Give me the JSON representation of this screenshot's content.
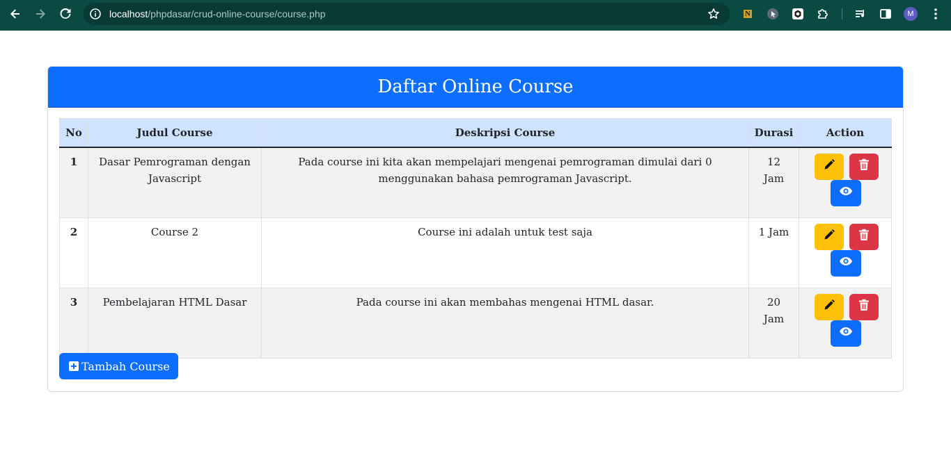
{
  "browser": {
    "url_host": "localhost",
    "url_path": "/phpdasar/crud-online-course/course.php",
    "extension_label": "N",
    "profile_initial": "M"
  },
  "page": {
    "title": "Daftar Online Course",
    "add_button_label": "Tambah Course"
  },
  "table": {
    "headers": {
      "no": "No",
      "judul": "Judul Course",
      "deskripsi": "Deskripsi Course",
      "durasi": "Durasi",
      "action": "Action"
    },
    "rows": [
      {
        "no": "1",
        "judul": "Dasar Pemrograman dengan Javascript",
        "deskripsi": "Pada course ini kita akan mempelajari mengenai pemrograman dimulai dari 0 menggunakan bahasa pemrograman Javascript.",
        "durasi": "12 Jam"
      },
      {
        "no": "2",
        "judul": "Course 2",
        "deskripsi": "Course ini adalah untuk test saja",
        "durasi": "1 Jam"
      },
      {
        "no": "3",
        "judul": "Pembelajaran HTML Dasar",
        "deskripsi": "Pada course ini akan membahas mengenai HTML dasar.",
        "durasi": "20 Jam"
      }
    ]
  },
  "icons": {
    "edit": "pencil-icon",
    "delete": "trash-icon",
    "view": "eye-icon",
    "add": "plus-square-icon"
  },
  "colors": {
    "primary": "#0d6efd",
    "warning": "#ffc107",
    "danger": "#dc3545",
    "table_header": "#cfe2ff",
    "browser_bar": "#0b4a43"
  }
}
